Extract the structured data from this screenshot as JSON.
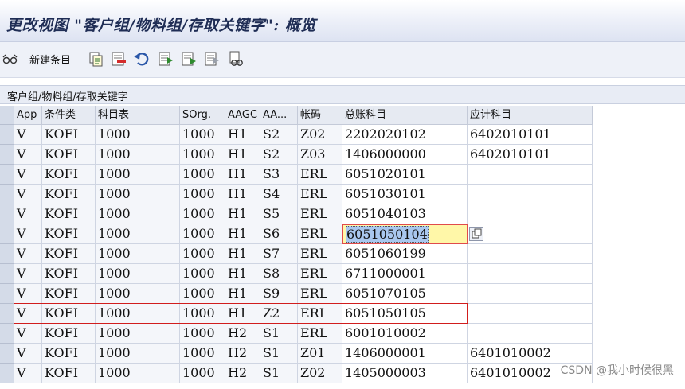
{
  "window": {
    "title": "更改视图 \"客户组/物料组/存取关键字\": 概览"
  },
  "toolbar": {
    "new_entries_label": "新建条目",
    "icons": [
      "glasses-icon",
      "copy-icon",
      "delete-icon",
      "undo-icon",
      "select-all-icon",
      "select-block-icon",
      "deselect-icon",
      "print-icon"
    ]
  },
  "group": {
    "label": "客户组/物料组/存取关键字"
  },
  "table": {
    "headers": [
      "App",
      "条件类",
      "科目表",
      "SOrg.",
      "AAGC",
      "AA...",
      "帐码",
      "总账科目",
      "应计科目"
    ],
    "rows": [
      [
        "V",
        "KOFI",
        "1000",
        "1000",
        "H1",
        "S2",
        "Z02",
        "2202020102",
        "6402010101"
      ],
      [
        "V",
        "KOFI",
        "1000",
        "1000",
        "H1",
        "S2",
        "Z03",
        "1406000000",
        "6402010101"
      ],
      [
        "V",
        "KOFI",
        "1000",
        "1000",
        "H1",
        "S3",
        "ERL",
        "6051020101",
        ""
      ],
      [
        "V",
        "KOFI",
        "1000",
        "1000",
        "H1",
        "S4",
        "ERL",
        "6051030101",
        ""
      ],
      [
        "V",
        "KOFI",
        "1000",
        "1000",
        "H1",
        "S5",
        "ERL",
        "6051040103",
        ""
      ],
      [
        "V",
        "KOFI",
        "1000",
        "1000",
        "H1",
        "S6",
        "ERL",
        "6051050104",
        ""
      ],
      [
        "V",
        "KOFI",
        "1000",
        "1000",
        "H1",
        "S7",
        "ERL",
        "6051060199",
        ""
      ],
      [
        "V",
        "KOFI",
        "1000",
        "1000",
        "H1",
        "S8",
        "ERL",
        "6711000001",
        ""
      ],
      [
        "V",
        "KOFI",
        "1000",
        "1000",
        "H1",
        "S9",
        "ERL",
        "6051070105",
        ""
      ],
      [
        "V",
        "KOFI",
        "1000",
        "1000",
        "H1",
        "Z2",
        "ERL",
        "6051050105",
        ""
      ],
      [
        "V",
        "KOFI",
        "1000",
        "1000",
        "H2",
        "S1",
        "ERL",
        "6001010002",
        ""
      ],
      [
        "V",
        "KOFI",
        "1000",
        "1000",
        "H2",
        "S1",
        "Z01",
        "1406000001",
        "6401010002"
      ],
      [
        "V",
        "KOFI",
        "1000",
        "1000",
        "H2",
        "S1",
        "Z02",
        "1405000003",
        "6401010002"
      ]
    ],
    "focused_row": 5,
    "highlighted_row": 9
  },
  "watermark": "CSDN @我小时候很黑",
  "colors": {
    "title": "#1f2d55",
    "highlight_border": "#d11d1d",
    "focus_fill": "#fff7a8",
    "selection": "#a9c7ee"
  }
}
